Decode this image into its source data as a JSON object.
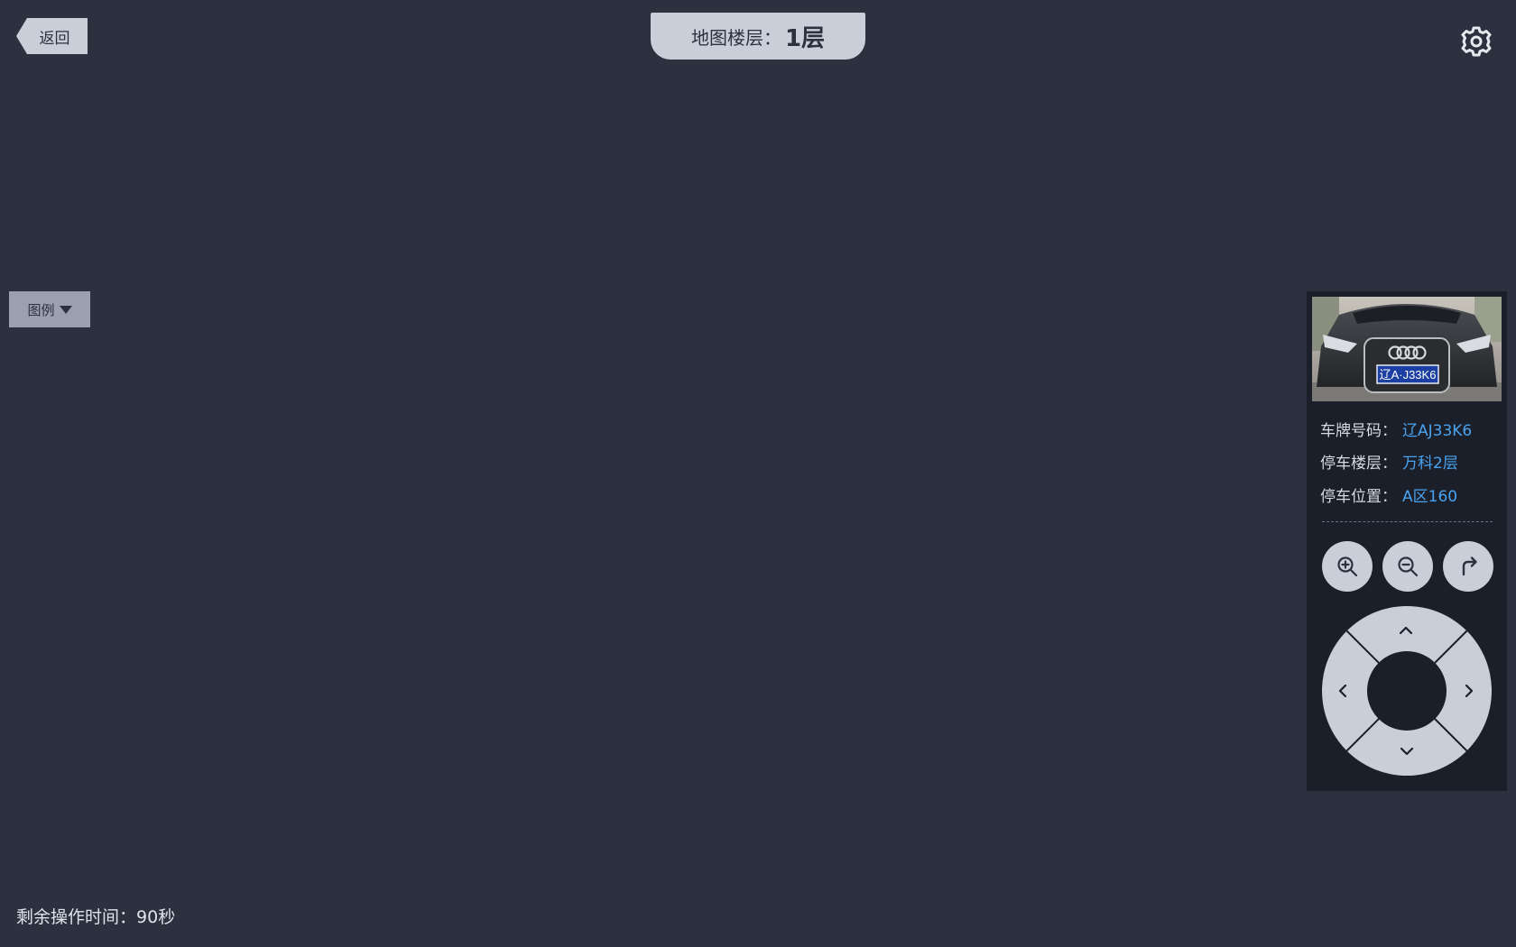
{
  "header": {
    "back_label": "返回",
    "floor_label": "地图楼层：",
    "floor_value": "1层",
    "settings_icon": "gear-icon"
  },
  "legend": {
    "label": "图例",
    "icon": "caret-down-icon"
  },
  "parking_info": {
    "plate_label": "车牌号码：",
    "plate_value": "辽AJ33K6",
    "floor_label": "停车楼层：",
    "floor_value": "万科2层",
    "position_label": "停车位置：",
    "position_value": "A区160",
    "photo_plate_text": "辽A·J33K6",
    "value_color": "#4aa3f0"
  },
  "controls": {
    "zoom_in_icon": "zoom-in-icon",
    "zoom_out_icon": "zoom-out-icon",
    "rotate_icon": "rotate-icon",
    "dpad_up_icon": "chevron-up-icon",
    "dpad_down_icon": "chevron-down-icon",
    "dpad_left_icon": "chevron-left-icon",
    "dpad_right_icon": "chevron-right-icon"
  },
  "footer": {
    "timer_label": "剩余操作时间：",
    "timer_value": "90秒"
  },
  "colors": {
    "background": "#2c3140",
    "panel": "#1b1f29",
    "button": "#c9ced9"
  }
}
